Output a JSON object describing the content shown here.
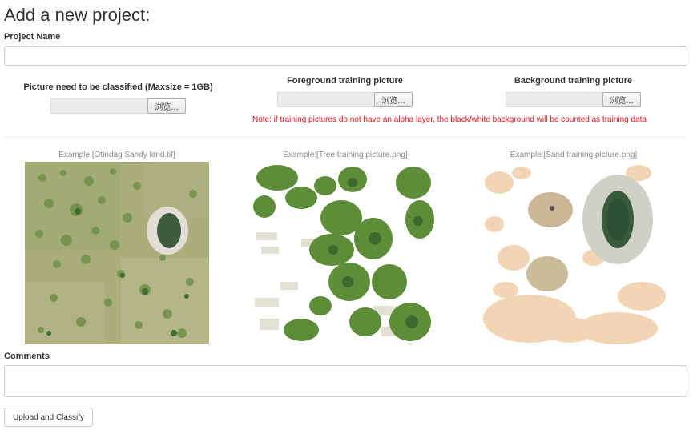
{
  "title": "Add a new project:",
  "project_name": {
    "label": "Project Name",
    "value": ""
  },
  "uploads": [
    {
      "label": "Picture need to be classified (Maxsize = 1GB)",
      "browse": "浏览..."
    },
    {
      "label": "Foreground training picture",
      "browse": "浏览..."
    },
    {
      "label": "Background training picture",
      "browse": "浏览..."
    }
  ],
  "note": "Note: if training pictures do not have an alpha layer, the black/white background will be counted as training data",
  "examples": [
    {
      "caption": "Example:[Otindag Sandy land.tif]"
    },
    {
      "caption": "Example:[Tree training picture.png]"
    },
    {
      "caption": "Example:[Sand training picture.png]"
    }
  ],
  "comments": {
    "label": "Comments",
    "value": ""
  },
  "submit_label": "Upload and Classify",
  "colors": {
    "note": "#e8101a",
    "caption": "#8a8a8a",
    "border": "#cccccc"
  }
}
